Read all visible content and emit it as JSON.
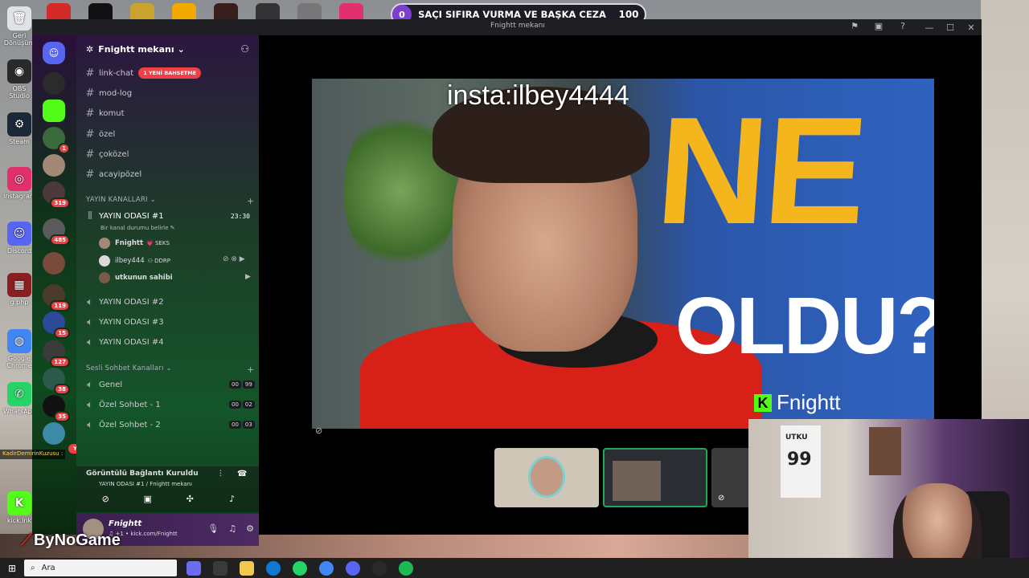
{
  "desktop": {
    "icons": [
      {
        "label": "Geri Dönüşüm",
        "color": "#dfe3e8",
        "glyph": "🗑"
      },
      {
        "label": "OBS Studio",
        "color": "#2a2a2a",
        "glyph": "◉"
      },
      {
        "label": "Steam",
        "color": "#1b2838",
        "glyph": "⚙"
      },
      {
        "label": "Instagram",
        "color": "#e1306c",
        "glyph": "◎"
      },
      {
        "label": "Discord",
        "color": "#5865f2",
        "glyph": "☺"
      },
      {
        "label": "g.php",
        "color": "#8b1e1e",
        "glyph": "▦"
      },
      {
        "label": "Google Chrome",
        "color": "#4285f4",
        "glyph": "◍"
      },
      {
        "label": "WhatsApp",
        "color": "#25d366",
        "glyph": "✆"
      },
      {
        "label": "kick.lnk",
        "color": "#53fc18",
        "glyph": "K"
      }
    ],
    "stream_logo": "ByNoGame"
  },
  "poll": {
    "left_count": "0",
    "question": "SAÇI SIFIRA VURMA VE BAŞKA CEZA",
    "right_count": "100"
  },
  "window": {
    "title": "Fnightt mekanı"
  },
  "rail": {
    "badges": [
      "1",
      "319",
      "485",
      "119",
      "15",
      "127",
      "38",
      "35"
    ],
    "new_label": "YENİ"
  },
  "server": {
    "name": "Fnightt mekanı"
  },
  "text_channels": [
    {
      "name": "link-chat",
      "mention": "1 YENİ BAHSETME"
    },
    {
      "name": "mod-log"
    },
    {
      "name": "komut"
    },
    {
      "name": "özel"
    },
    {
      "name": "çoközel"
    },
    {
      "name": "acayipözel"
    }
  ],
  "categories": {
    "stream": "YAYIN KANALLARI",
    "voice": "Sesli Sohbet Kanalları"
  },
  "active_voice": {
    "name": "YAYIN ODASI #1",
    "time": "23:30",
    "status_hint": "Bir kanal durumu belirle",
    "members": [
      {
        "name": "Fnightt",
        "tag": "💗 SEKS"
      },
      {
        "name": "ilbey444",
        "tag": "⚇ DDRP"
      },
      {
        "name": "utkunun sahibi",
        "tag": ""
      }
    ]
  },
  "voice_rooms": [
    "YAYIN ODASI #2",
    "YAYIN ODASI #3",
    "YAYIN ODASI #4"
  ],
  "chat_channels": [
    {
      "name": "Genel",
      "count_a": "00",
      "count_b": "99"
    },
    {
      "name": "Özel Sohbet - 1",
      "count_a": "00",
      "count_b": "02"
    },
    {
      "name": "Özel Sohbet - 2",
      "count_a": "00",
      "count_b": "03"
    }
  ],
  "voice_panel": {
    "title": "Görüntülü Bağlantı Kuruldu",
    "subtitle": "YAYIN ODASI #1 / Fnightt mekanı"
  },
  "user_panel": {
    "name": "Fnightt",
    "status": "♫ +1 • kick.com/Fnightt"
  },
  "chat_overlay": {
    "user": "KadirDemirinKuzusu :",
    "message": ""
  },
  "video": {
    "watermark": "insta:ilbey4444",
    "headline_1": "NE",
    "headline_2": "OLDU?",
    "brand": "Fnightt"
  },
  "webcam": {
    "shirt_text": "99",
    "shirt_name": "UTKU"
  },
  "taskbar": {
    "search_placeholder": "Ara"
  },
  "colors": {
    "discord_blurple": "#5865f2",
    "accent_red": "#f23f43",
    "kick_green": "#53fc18",
    "active_border": "#23a55a"
  }
}
